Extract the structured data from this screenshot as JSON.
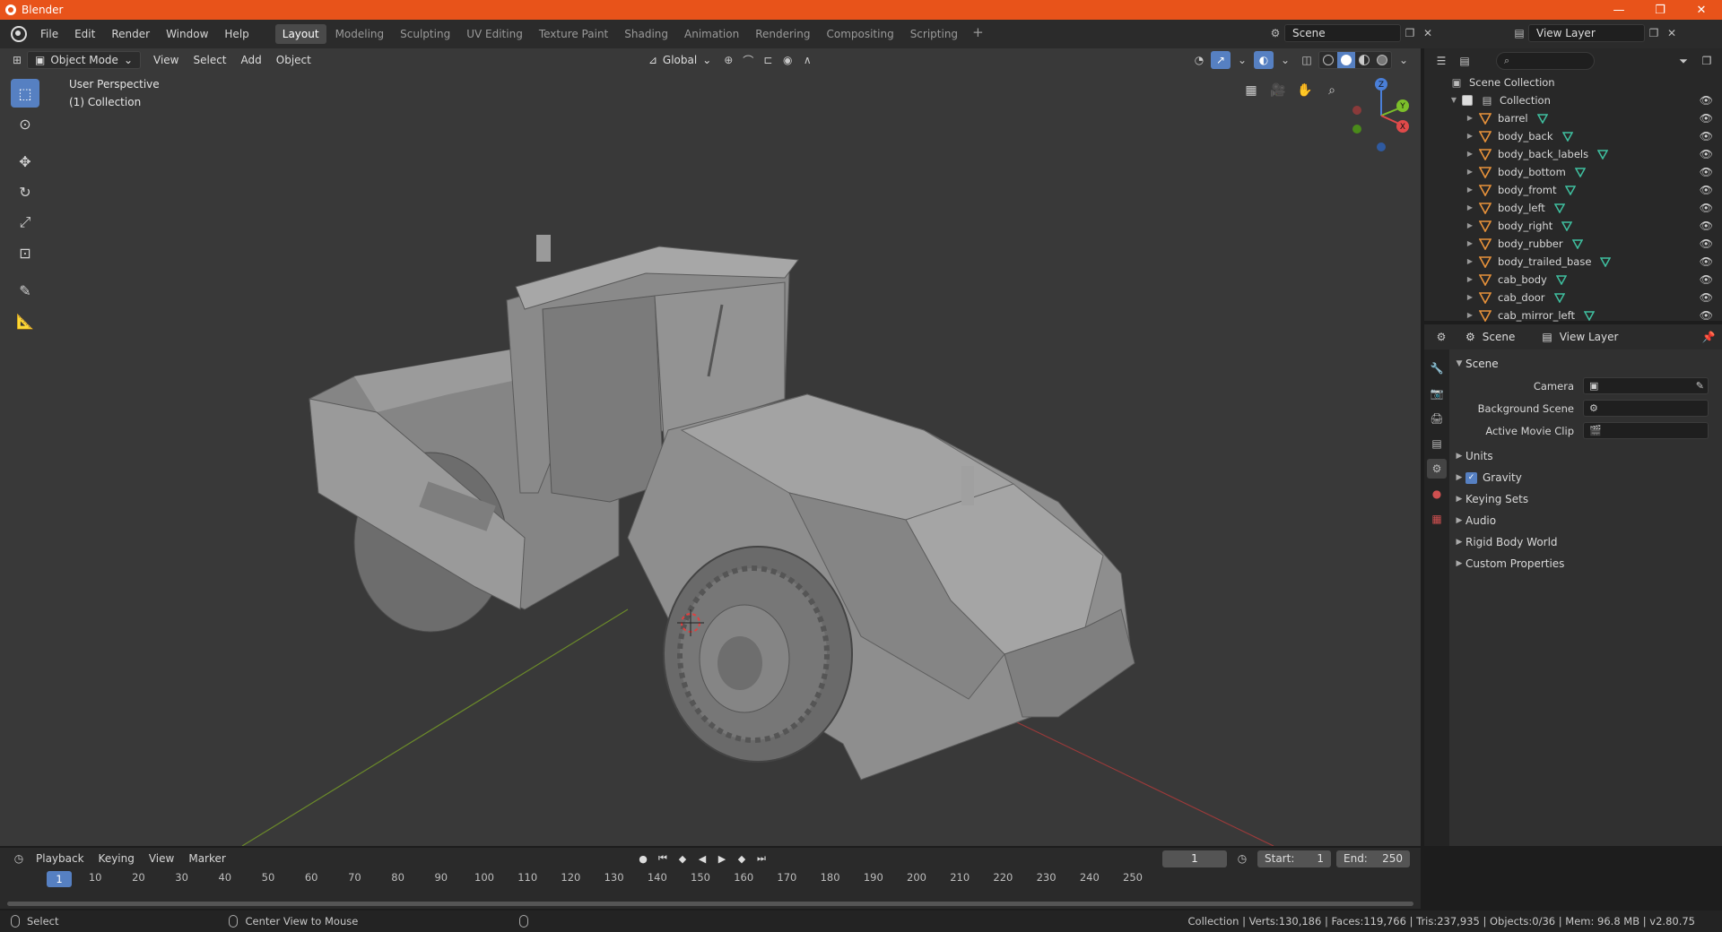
{
  "window": {
    "title": "Blender",
    "minimize": "—",
    "maximize": "❐",
    "close": "✕"
  },
  "menu": [
    "File",
    "Edit",
    "Render",
    "Window",
    "Help"
  ],
  "workspaces": [
    "Layout",
    "Modeling",
    "Sculpting",
    "UV Editing",
    "Texture Paint",
    "Shading",
    "Animation",
    "Rendering",
    "Compositing",
    "Scripting"
  ],
  "workspace_add": "+",
  "scene_name": "Scene",
  "view_layer_name": "View Layer",
  "viewport": {
    "mode": "Object Mode",
    "menus": [
      "View",
      "Select",
      "Add",
      "Object"
    ],
    "orientation": "Global",
    "info_line1": "User Perspective",
    "info_line2": "(1) Collection",
    "gizmo": {
      "x": "X",
      "y": "Y",
      "z": "Z"
    }
  },
  "outliner": {
    "root": "Scene Collection",
    "collection": "Collection",
    "items": [
      "barrel",
      "body_back",
      "body_back_labels",
      "body_bottom",
      "body_fromt",
      "body_left",
      "body_right",
      "body_rubber",
      "body_trailed_base",
      "cab_body",
      "cab_door",
      "cab_mirror_left"
    ]
  },
  "properties": {
    "tab_scene": "Scene",
    "tab_layer": "View Layer",
    "panel": "Scene",
    "camera_label": "Camera",
    "bg_scene_label": "Background Scene",
    "movie_clip_label": "Active Movie Clip",
    "subpanels": [
      "Units",
      "Gravity",
      "Keying Sets",
      "Audio",
      "Rigid Body World",
      "Custom Properties"
    ]
  },
  "timeline": {
    "menus": [
      "Playback",
      "Keying",
      "View",
      "Marker"
    ],
    "current_frame": "1",
    "start_label": "Start:",
    "start_value": "1",
    "end_label": "End:",
    "end_value": "250",
    "ticks": [
      "10",
      "20",
      "30",
      "40",
      "50",
      "60",
      "70",
      "80",
      "90",
      "100",
      "110",
      "120",
      "130",
      "140",
      "150",
      "160",
      "170",
      "180",
      "190",
      "200",
      "210",
      "220",
      "230",
      "240",
      "250"
    ],
    "cursor_label": "1"
  },
  "status": {
    "select": "Select",
    "center_view": "Center View to Mouse",
    "stats": "Collection | Verts:130,186 | Faces:119,766 | Tris:237,935 | Objects:0/36 | Mem: 96.8 MB | v2.80.75"
  },
  "colors": {
    "accent": "#5680c2",
    "titlebar": "#e8531a",
    "mesh_icon": "#e8923a",
    "data_icon": "#3fc0a0"
  }
}
